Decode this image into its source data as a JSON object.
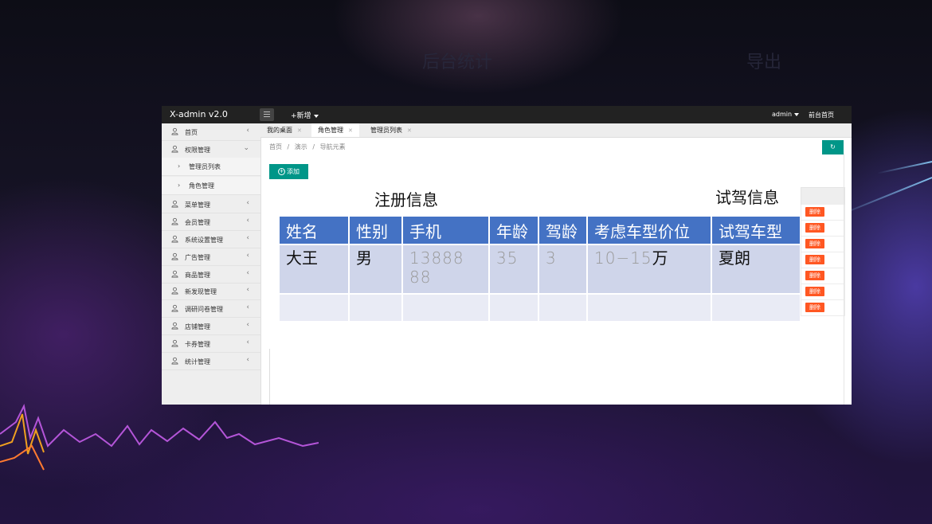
{
  "background": {
    "faint_titles": [
      "后台统计",
      "导出"
    ]
  },
  "app": {
    "logo": "X-admin v2.0",
    "new_label": "+新增",
    "user": "admin",
    "front_home": "前台首页"
  },
  "sidebar": {
    "items": [
      {
        "label": "首页",
        "type": "nav",
        "chevron": "‹"
      },
      {
        "label": "权限管理",
        "type": "nav",
        "chevron": "⌄"
      },
      {
        "label": "管理员列表",
        "type": "sub"
      },
      {
        "label": "角色管理",
        "type": "sub"
      },
      {
        "label": "菜单管理",
        "type": "nav",
        "chevron": "‹"
      },
      {
        "label": "会员管理",
        "type": "nav",
        "chevron": "‹"
      },
      {
        "label": "系统设置管理",
        "type": "nav",
        "chevron": "‹"
      },
      {
        "label": "广告管理",
        "type": "nav",
        "chevron": "‹"
      },
      {
        "label": "商品管理",
        "type": "nav",
        "chevron": "‹"
      },
      {
        "label": "新发现管理",
        "type": "nav",
        "chevron": "‹"
      },
      {
        "label": "调研问卷管理",
        "type": "nav",
        "chevron": "‹"
      },
      {
        "label": "店铺管理",
        "type": "nav",
        "chevron": "‹"
      },
      {
        "label": "卡券管理",
        "type": "nav",
        "chevron": "‹"
      },
      {
        "label": "统计管理",
        "type": "nav",
        "chevron": "‹"
      }
    ]
  },
  "tabs": [
    {
      "label": "我的桌面",
      "active": false
    },
    {
      "label": "角色管理",
      "active": true
    },
    {
      "label": "管理员列表",
      "active": false
    }
  ],
  "breadcrumb": [
    "首页",
    "/",
    "演示",
    "/",
    "导航元素"
  ],
  "refresh_icon": "↻",
  "add_button": "添加",
  "delete_label": "删除",
  "delete_count": 7,
  "overlay": {
    "section_left": "注册信息",
    "section_right": "试驾信息",
    "headers": [
      "姓名",
      "性别",
      "手机",
      "年龄",
      "驾龄",
      "考虑车型价位",
      "试驾车型"
    ],
    "row1": {
      "name": "大王",
      "gender": "男",
      "phone_line1": "13888",
      "phone_line2": "88",
      "age": "35",
      "driving_years": "3",
      "price_range": "10−15",
      "price_unit": "万",
      "test_model": "夏朗"
    }
  },
  "colors": {
    "header_blue": "#4472c4",
    "row_light": "#cfd5ea",
    "row_lighter": "#e9ebf5",
    "teal": "#009688",
    "delete_red": "#ff5722"
  }
}
